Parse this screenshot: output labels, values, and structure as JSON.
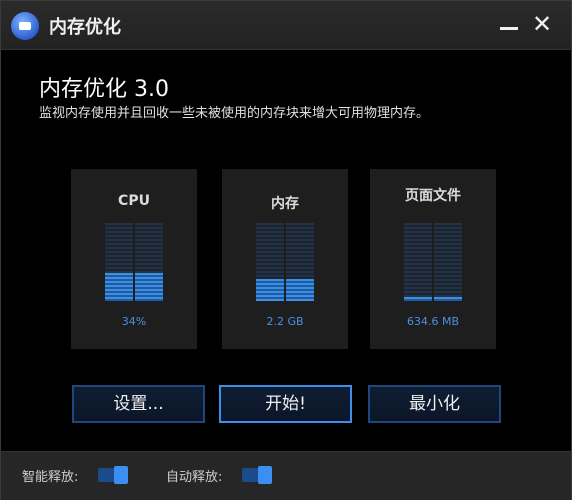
{
  "window": {
    "title": "内存优化",
    "minimize_label": "_",
    "close_label": "✕"
  },
  "header": {
    "title": "内存优化 3.0",
    "description": "监视内存使用并且回收一些未被使用的内存块来增大可用物理内存。"
  },
  "meters": [
    {
      "label": "CPU",
      "value": "34%",
      "level": 0.36
    },
    {
      "label": "内存",
      "value": "2.2 GB",
      "level": 0.28
    },
    {
      "label": "页面文件",
      "value": "634.6 MB",
      "level": 0.05
    }
  ],
  "buttons": {
    "settings": "设置...",
    "start": "开始!",
    "minimize": "最小化"
  },
  "footer": {
    "smart_release_label": "智能释放:",
    "auto_release_label": "自动释放:",
    "smart_release_on": true,
    "auto_release_on": true
  },
  "colors": {
    "accent": "#3d8fe8",
    "meter_value": "#4a90e8"
  }
}
